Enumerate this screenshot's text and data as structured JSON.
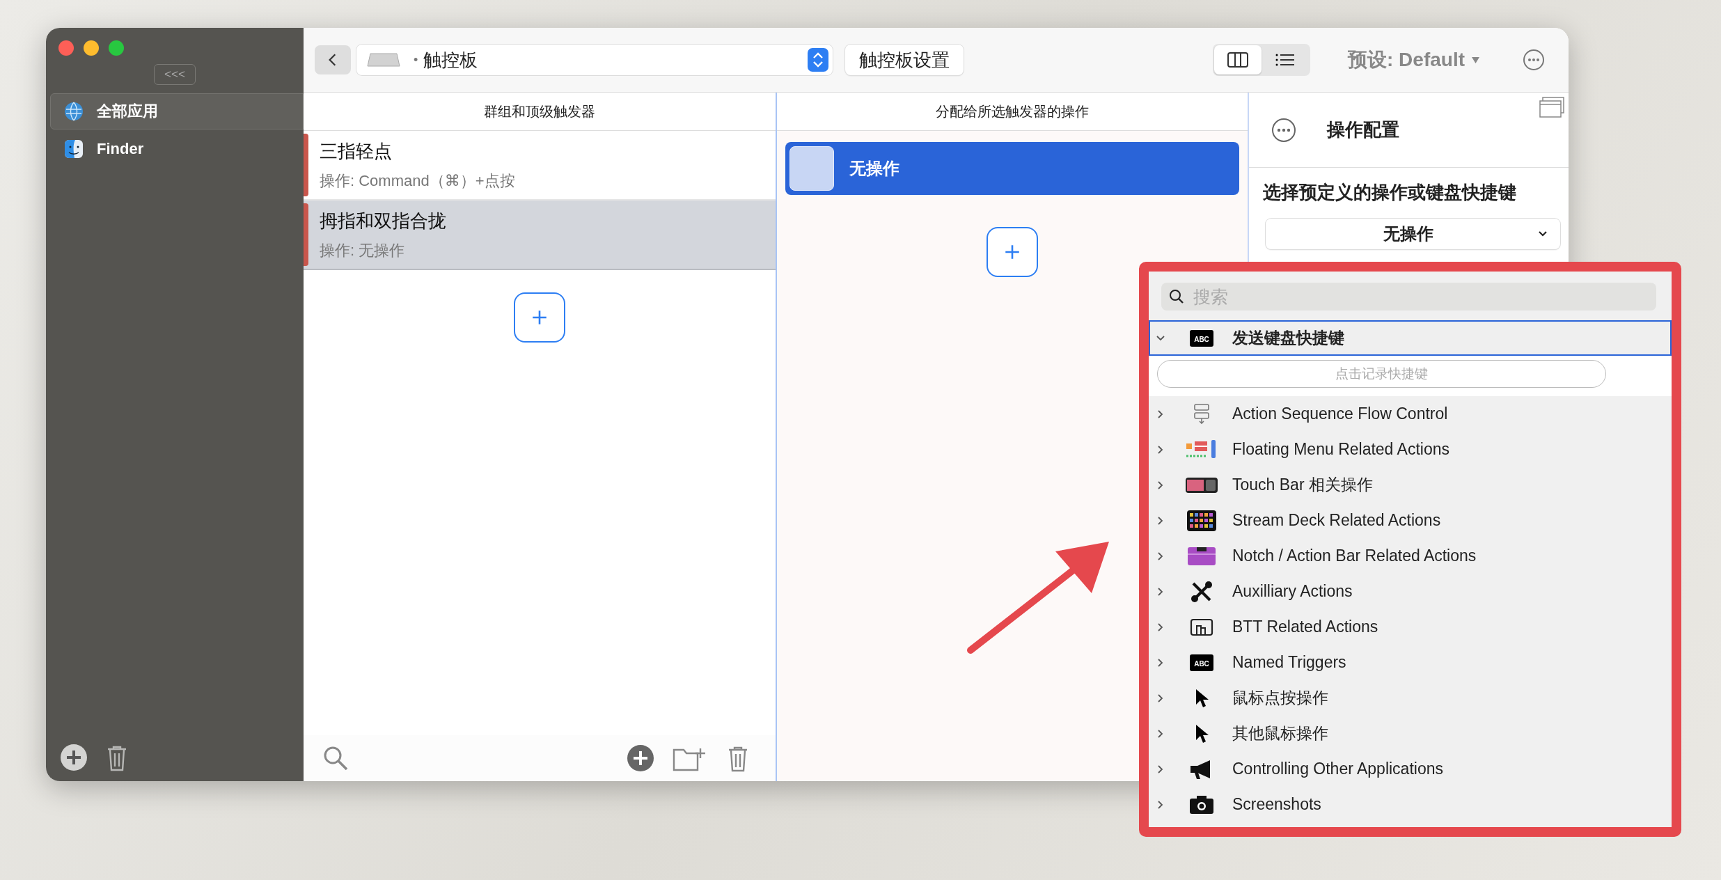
{
  "sidebar": {
    "collapse_button": "<<<",
    "items": [
      {
        "label": "全部应用",
        "kind": "globe",
        "selected": true
      },
      {
        "label": "Finder",
        "kind": "finder",
        "selected": false
      }
    ]
  },
  "toolbar": {
    "device_bullet": "•",
    "device": "触控板",
    "settings_button": "触控板设置",
    "view_modes": [
      {
        "kind": "columns",
        "selected": true
      },
      {
        "kind": "list",
        "selected": false
      }
    ],
    "preset": "预设: Default"
  },
  "triggers": {
    "header": "群组和顶级触发器",
    "items": [
      {
        "title": "三指轻点",
        "action": "操作: Command（⌘）+点按",
        "selected": false
      },
      {
        "title": "拇指和双指合拢",
        "action": "操作: 无操作",
        "selected": true
      }
    ]
  },
  "actions": {
    "header": "分配给所选触发器的操作",
    "items": [
      {
        "label": "无操作",
        "selected": true
      }
    ]
  },
  "config": {
    "title": "操作配置",
    "prompt": "选择预定义的操作或键盘快捷键",
    "dropdown_value": "无操作"
  },
  "popup": {
    "search_placeholder": "搜索",
    "categories": [
      {
        "label": "发送键盘快捷键",
        "kind": "abc",
        "icon_text": "ABC",
        "expanded": true,
        "selected": true,
        "field_placeholder": "点击记录快捷键"
      },
      {
        "label": "Action Sequence Flow Control",
        "kind": "flow",
        "expanded": false,
        "selected": false
      },
      {
        "label": "Floating Menu Related Actions",
        "kind": "menu",
        "expanded": false,
        "selected": false
      },
      {
        "label": "Touch Bar 相关操作",
        "kind": "touchbar",
        "expanded": false,
        "selected": false
      },
      {
        "label": "Stream Deck Related Actions",
        "kind": "deck",
        "expanded": false,
        "selected": false
      },
      {
        "label": "Notch / Action Bar Related Actions",
        "kind": "notch",
        "expanded": false,
        "selected": false
      },
      {
        "label": "Auxilliary Actions",
        "kind": "tools",
        "expanded": false,
        "selected": false
      },
      {
        "label": "BTT Related Actions",
        "kind": "btt",
        "expanded": false,
        "selected": false
      },
      {
        "label": "Named Triggers",
        "kind": "abc",
        "icon_text": "ABC",
        "expanded": false,
        "selected": false
      },
      {
        "label": "鼠标点按操作",
        "kind": "cursor",
        "expanded": false,
        "selected": false
      },
      {
        "label": "其他鼠标操作",
        "kind": "cursor",
        "expanded": false,
        "selected": false
      },
      {
        "label": "Controlling Other Applications",
        "kind": "megaphone",
        "expanded": false,
        "selected": false
      },
      {
        "label": "Screenshots",
        "kind": "camera",
        "expanded": false,
        "selected": false
      }
    ]
  }
}
